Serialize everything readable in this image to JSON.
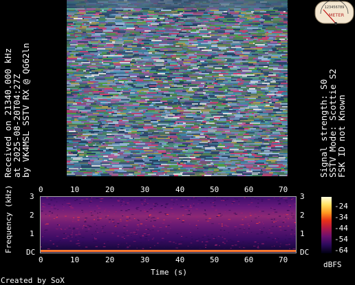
{
  "rx_info": {
    "line1": "Received on  21340.000 kHz",
    "line2": "at 2025-08-20T04:27Z",
    "line3": "by VK4MSL SSTV RX @ QG62ln"
  },
  "signal_info": {
    "line1": "Signal strength: S0",
    "line2": "SSTV Mode: Scottie S2",
    "line3": "FSK ID not Known"
  },
  "meter": {
    "label": "METER",
    "scale": "123456789"
  },
  "spectrogram": {
    "x_ticks": [
      "0",
      "10",
      "20",
      "30",
      "40",
      "50",
      "60",
      "70"
    ],
    "y_ticks_left": [
      "3",
      "2",
      "1",
      "DC"
    ],
    "y_ticks_right": [
      "3",
      "2",
      "1",
      "DC"
    ],
    "xlabel": "Time (s)",
    "ylabel": "Frequency (kHz)"
  },
  "colorbar": {
    "ticks": [
      "-24",
      "-34",
      "-44",
      "-54",
      "-64"
    ],
    "unit": "dBFS"
  },
  "credit": "Created by SoX"
}
